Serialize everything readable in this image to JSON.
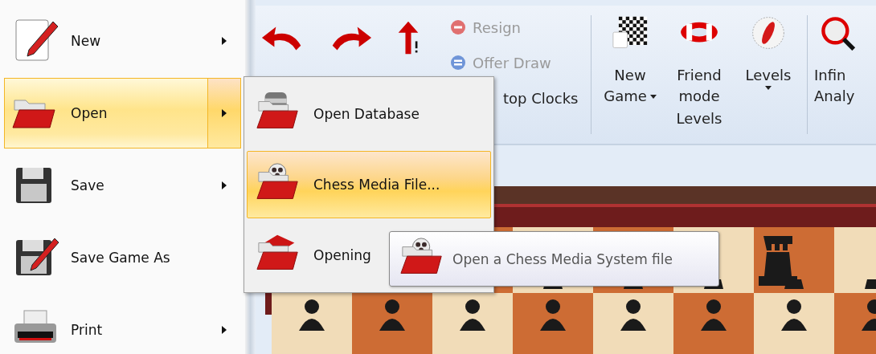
{
  "file_menu": {
    "items": [
      {
        "label": "New",
        "submenu": true,
        "selected": false
      },
      {
        "label": "Open",
        "submenu": true,
        "selected": true
      },
      {
        "label": "Save",
        "submenu": true,
        "selected": false
      },
      {
        "label": "Save Game As",
        "submenu": false,
        "selected": false
      },
      {
        "label": "Print",
        "submenu": true,
        "selected": false
      }
    ]
  },
  "ribbon": {
    "small_buttons": [
      {
        "label": "Resign",
        "disabled": true
      },
      {
        "label": "Offer Draw",
        "disabled": true
      },
      {
        "label": "top Clocks",
        "disabled": false
      }
    ],
    "levels_group": {
      "buttons": [
        {
          "lines": [
            "New",
            "Game"
          ],
          "dropdown": true
        },
        {
          "lines": [
            "Friend",
            "mode"
          ],
          "dropdown": false
        },
        {
          "lines": [
            "Levels"
          ],
          "dropdown": true
        }
      ],
      "group_label": "Levels"
    },
    "analysis_button": {
      "lines": [
        "Infin",
        "Analy"
      ]
    }
  },
  "submenu": {
    "items": [
      {
        "label": "Open Database",
        "selected": false
      },
      {
        "label": "Chess Media File...",
        "selected": true
      },
      {
        "label": "Opening",
        "selected": false
      }
    ]
  },
  "tooltip": {
    "text": "Open a Chess Media System file"
  }
}
